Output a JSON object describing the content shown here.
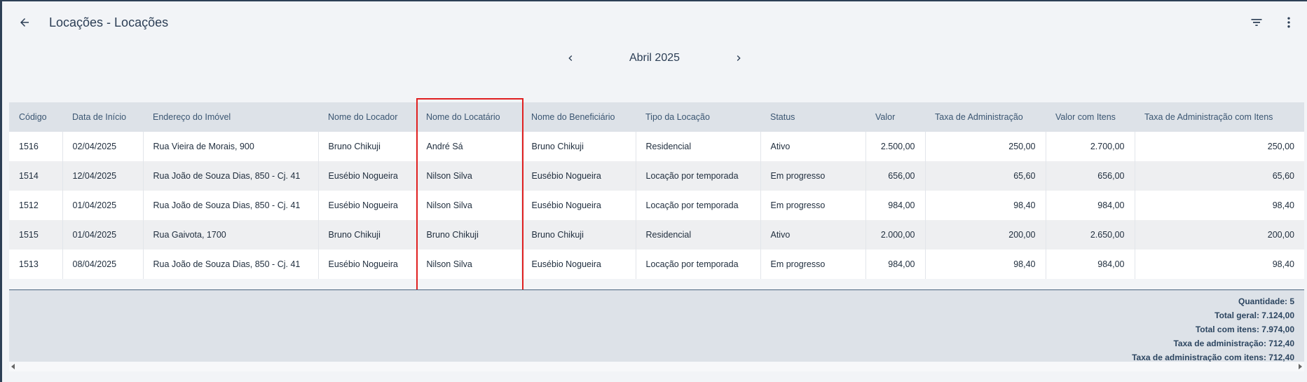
{
  "header": {
    "title": "Locações - Locações",
    "back_icon": "arrow-left-icon",
    "filter_icon": "filter-icon",
    "more_icon": "more-vertical-icon"
  },
  "month_nav": {
    "label": "Abril 2025"
  },
  "table": {
    "columns": [
      "Código",
      "Data de Início",
      "Endereço do Imóvel",
      "Nome do Locador",
      "Nome do Locatário",
      "Nome do Beneficiário",
      "Tipo da Locação",
      "Status",
      "Valor",
      "Taxa de Administração",
      "Valor com Itens",
      "Taxa de Administração com Itens"
    ],
    "rows": [
      [
        "1516",
        "02/04/2025",
        "Rua Vieira de Morais, 900",
        "Bruno Chikuji",
        "André Sá",
        "Bruno Chikuji",
        "Residencial",
        "Ativo",
        "2.500,00",
        "250,00",
        "2.700,00",
        "250,00"
      ],
      [
        "1514",
        "12/04/2025",
        "Rua João de Souza Dias, 850 - Cj. 41",
        "Eusébio Nogueira",
        "Nilson Silva",
        "Eusébio Nogueira",
        "Locação por temporada",
        "Em progresso",
        "656,00",
        "65,60",
        "656,00",
        "65,60"
      ],
      [
        "1512",
        "01/04/2025",
        "Rua João de Souza Dias, 850 - Cj. 41",
        "Eusébio Nogueira",
        "Nilson Silva",
        "Eusébio Nogueira",
        "Locação por temporada",
        "Em progresso",
        "984,00",
        "98,40",
        "984,00",
        "98,40"
      ],
      [
        "1515",
        "01/04/2025",
        "Rua Gaivota, 1700",
        "Bruno Chikuji",
        "Bruno Chikuji",
        "Bruno Chikuji",
        "Residencial",
        "Ativo",
        "2.000,00",
        "200,00",
        "2.650,00",
        "200,00"
      ],
      [
        "1513",
        "08/04/2025",
        "Rua João de Souza Dias, 850 - Cj. 41",
        "Eusébio Nogueira",
        "Nilson Silva",
        "Eusébio Nogueira",
        "Locação por temporada",
        "Em progresso",
        "984,00",
        "98,40",
        "984,00",
        "98,40"
      ]
    ]
  },
  "summary": {
    "quantidade": "Quantidade: 5",
    "total_geral": "Total geral: 7.124,00",
    "total_itens": "Total com itens: 7.974,00",
    "taxa_admin": "Taxa de administração: 712,40",
    "taxa_admin_itens": "Taxa de administração com itens: 712,40"
  },
  "colors": {
    "highlight": "#e02020",
    "header_bg": "#dde2e8",
    "accent": "#2c3e55"
  }
}
